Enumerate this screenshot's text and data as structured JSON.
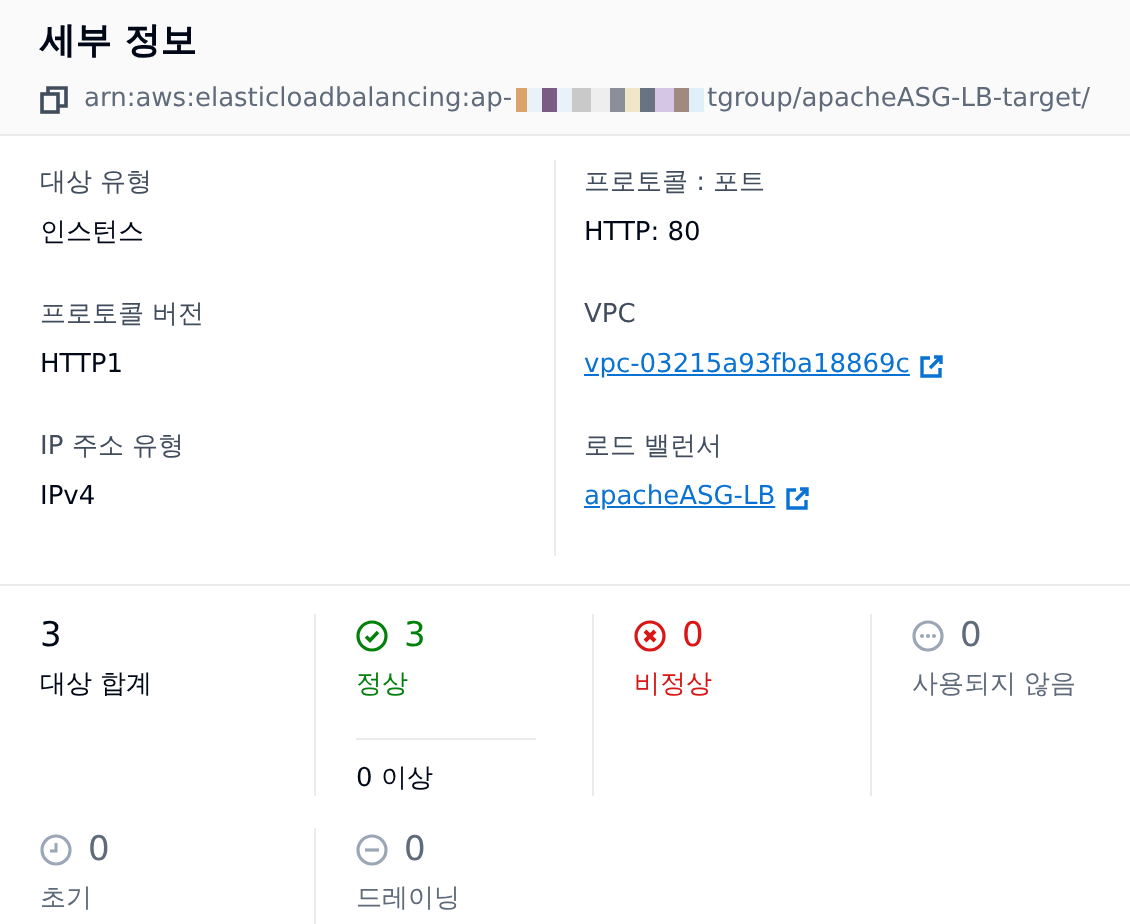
{
  "header": {
    "title": "세부 정보",
    "arn_prefix": "arn:aws:elasticloadbalancing:ap-",
    "arn_suffix": "tgroup/apacheASG-LB-target/"
  },
  "details": [
    {
      "label": "대상 유형",
      "value": "인스턴스",
      "kind": "text"
    },
    {
      "label": "프로토콜 : 포트",
      "value": "HTTP: 80",
      "kind": "text"
    },
    {
      "label": "프로토콜 버전",
      "value": "HTTP1",
      "kind": "text"
    },
    {
      "label": "VPC",
      "value": "vpc-03215a93fba18869c",
      "kind": "link"
    },
    {
      "label": "IP 주소 유형",
      "value": "IPv4",
      "kind": "text"
    },
    {
      "label": "로드 밸런서",
      "value": "apacheASG-LB",
      "kind": "link"
    }
  ],
  "stats": [
    {
      "kind": "total",
      "count": "3",
      "label": "대상 합계"
    },
    {
      "kind": "healthy",
      "count": "3",
      "label": "정상",
      "sub": "0 이상"
    },
    {
      "kind": "unhealthy",
      "count": "0",
      "label": "비정상"
    },
    {
      "kind": "unused",
      "count": "0",
      "label": "사용되지 않음"
    },
    {
      "kind": "initial",
      "count": "0",
      "label": "초기"
    },
    {
      "kind": "draining",
      "count": "0",
      "label": "드레이닝"
    }
  ]
}
